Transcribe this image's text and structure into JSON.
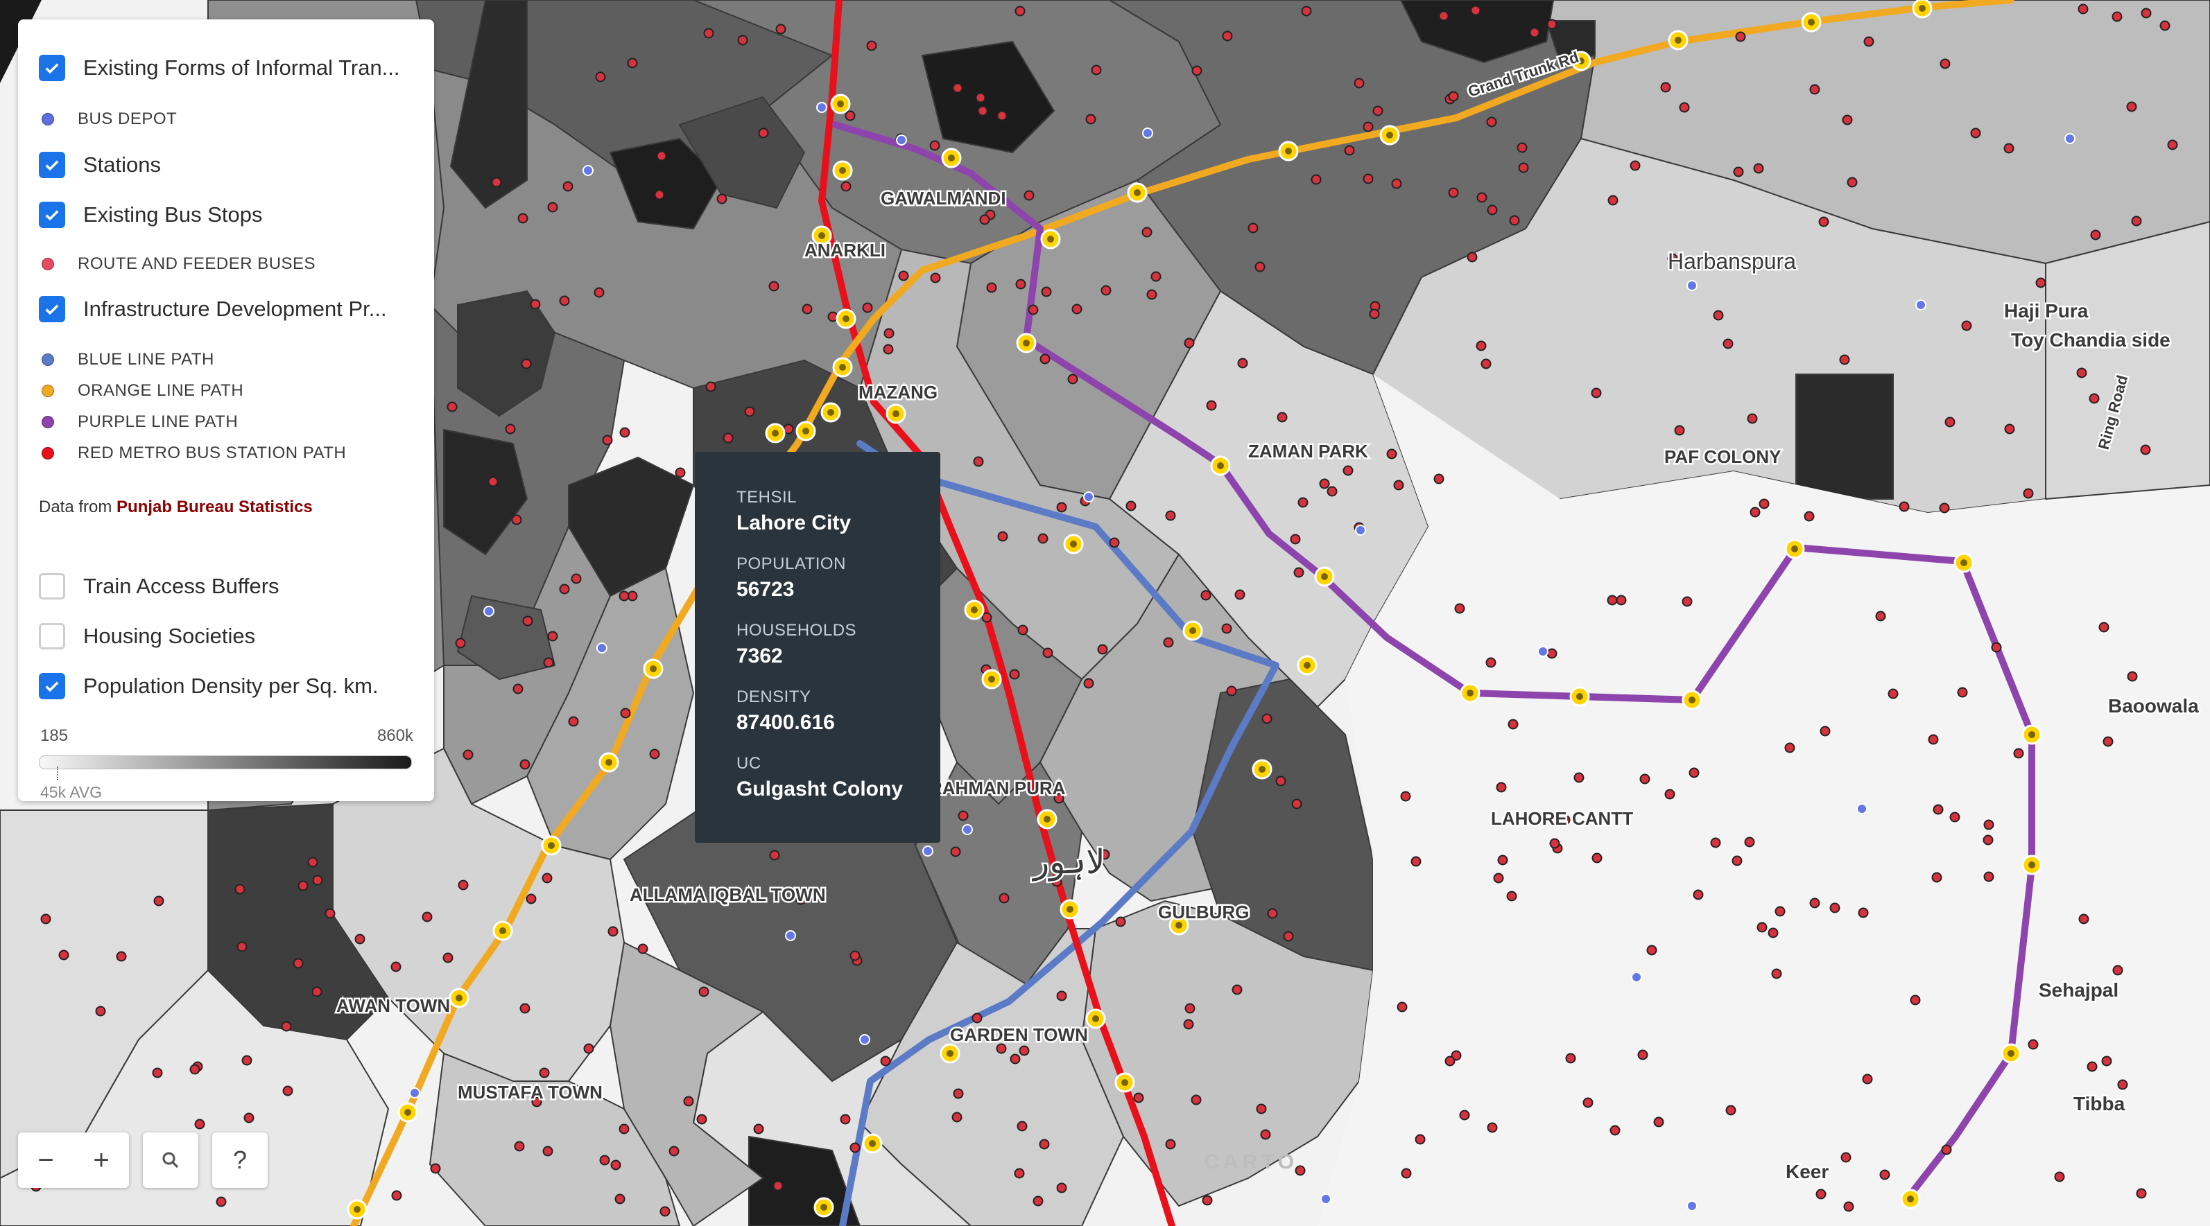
{
  "legend": {
    "layers": [
      {
        "label": "Existing Forms of Informal Tran...",
        "checked": true
      },
      {
        "label": "Stations",
        "checked": true
      },
      {
        "label": "Existing Bus Stops",
        "checked": true
      },
      {
        "label": "Infrastructure Development Pr...",
        "checked": true
      },
      {
        "label": "Train Access Buffers",
        "checked": false
      },
      {
        "label": "Housing Societies",
        "checked": false
      },
      {
        "label": "Population Density per Sq. km.",
        "checked": true
      }
    ],
    "sublegend": [
      {
        "label": "BUS DEPOT",
        "color": "#5b6fe0"
      },
      {
        "label": "ROUTE AND FEEDER BUSES",
        "color": "#e84a5f"
      },
      {
        "label": "BLUE LINE PATH",
        "color": "#5b7bc6"
      },
      {
        "label": "ORANGE LINE PATH",
        "color": "#f0a920"
      },
      {
        "label": "PURPLE LINE PATH",
        "color": "#8e44ad"
      },
      {
        "label": "RED METRO BUS STATION PATH",
        "color": "#e8101a"
      }
    ],
    "source_prefix": "Data from ",
    "source_link": "Punjab Bureau Statistics",
    "density": {
      "min_label": "185",
      "max_label": "860k",
      "avg_label": "45k AVG"
    }
  },
  "tooltip": {
    "fields": [
      {
        "key": "TEHSIL",
        "value": "Lahore City"
      },
      {
        "key": "POPULATION",
        "value": "56723"
      },
      {
        "key": "HOUSEHOLDS",
        "value": "7362"
      },
      {
        "key": "DENSITY",
        "value": "87400.616"
      },
      {
        "key": "UC",
        "value": "Gulgasht Colony"
      }
    ]
  },
  "controls": {
    "zoom_out": "−",
    "zoom_in": "+",
    "search": "🔍",
    "help": "?"
  },
  "attribution": "CARTO",
  "map_labels": [
    "Grand Trunk Rd",
    "GAWALMANDI",
    "ANARKLI",
    "MAZANG",
    "Harbanspura",
    "Haji Pura",
    "Toy Chandia side",
    "ZAMAN PARK",
    "PAF COLONY",
    "Ring Road",
    "Baoowala",
    "RAHMAN PURA",
    "LAHORE CANTT",
    "ALLAMA IQBAL TOWN",
    "GULBURG",
    "لاہور",
    "AWAN TOWN",
    "GARDEN TOWN",
    "MUSTAFA TOWN",
    "Sehajpal",
    "Tibba",
    "Keer"
  ],
  "colors": {
    "blue_line": "#5b7bc6",
    "orange_line": "#f0a920",
    "purple_line": "#8e44ad",
    "red_line": "#e8101a",
    "station_fill": "#ffd400",
    "bus_stop": "#d9323f",
    "bus_depot": "#6378e6"
  }
}
